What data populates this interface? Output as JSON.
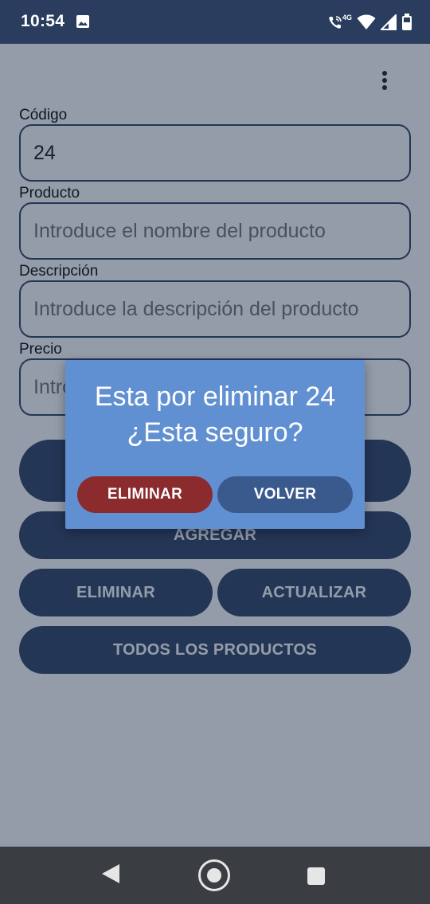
{
  "status_bar": {
    "time": "10:54",
    "network": "4G",
    "icons": [
      "image-icon",
      "wifi-call-icon",
      "wifi-icon",
      "signal-icon",
      "battery-icon"
    ]
  },
  "form": {
    "code": {
      "label": "Código",
      "value": "24"
    },
    "product": {
      "label": "Producto",
      "placeholder": "Introduce el nombre del producto"
    },
    "description": {
      "label": "Descripción",
      "placeholder": "Introduce la descripción del producto"
    },
    "price": {
      "label": "Precio",
      "placeholder": "Introduce el precio del producto"
    }
  },
  "buttons": {
    "search": "",
    "add": "AGREGAR",
    "delete": "ELIMINAR",
    "update": "ACTUALIZAR",
    "all_products": "TODOS LOS PRODUCTOS"
  },
  "dialog": {
    "line1": "Esta por eliminar 24",
    "line2": "¿Esta seguro?",
    "confirm_label": "ELIMINAR",
    "cancel_label": "VOLVER"
  },
  "colors": {
    "primary": "#2a3d5e",
    "dialog_bg": "#6190d2",
    "danger": "#8b2b2e",
    "secondary": "#3a5a8e"
  }
}
